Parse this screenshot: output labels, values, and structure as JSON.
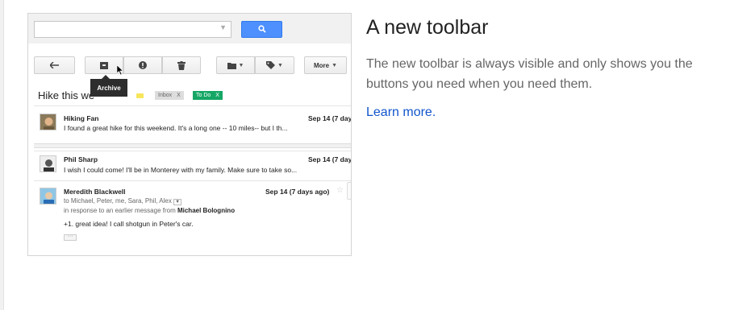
{
  "search": {
    "placeholder": ""
  },
  "toolbar": {
    "more_label": "More",
    "tooltip": "Archive"
  },
  "thread": {
    "subject": "Hike this we",
    "labels": [
      {
        "name": "Inbox",
        "close": "X"
      },
      {
        "name": "To Do",
        "close": "X"
      }
    ]
  },
  "messages": [
    {
      "sender": "Hiking Fan",
      "date": "Sep 14 (7 day",
      "snippet": "I found a great hike for this weekend. It's a long one -- 10 miles-- but I th..."
    },
    {
      "sender": "Phil Sharp",
      "date": "Sep 14 (7 day",
      "snippet": "I wish I could come! I'll be in Monterey with my family. Make sure to take so..."
    },
    {
      "sender": "Meredith Blackwell",
      "date": "Sep 14 (7 days ago)",
      "to": "to Michael, Peter, me, Sara, Phil, Alex",
      "reply_prefix": "in response to an earlier message from",
      "reply_name": "Michael Bolognino",
      "body": "+1. great idea! I call shotgun in Peter's car.",
      "ellipsis": "···"
    }
  ],
  "feature": {
    "title": "A new toolbar",
    "description": "The new toolbar is always visible and only shows you the buttons you need when you need them.",
    "learn_more": "Learn more."
  },
  "colors": {
    "search_button": "#4d90fe",
    "todo_label": "#16a765",
    "link": "#1155cc"
  }
}
